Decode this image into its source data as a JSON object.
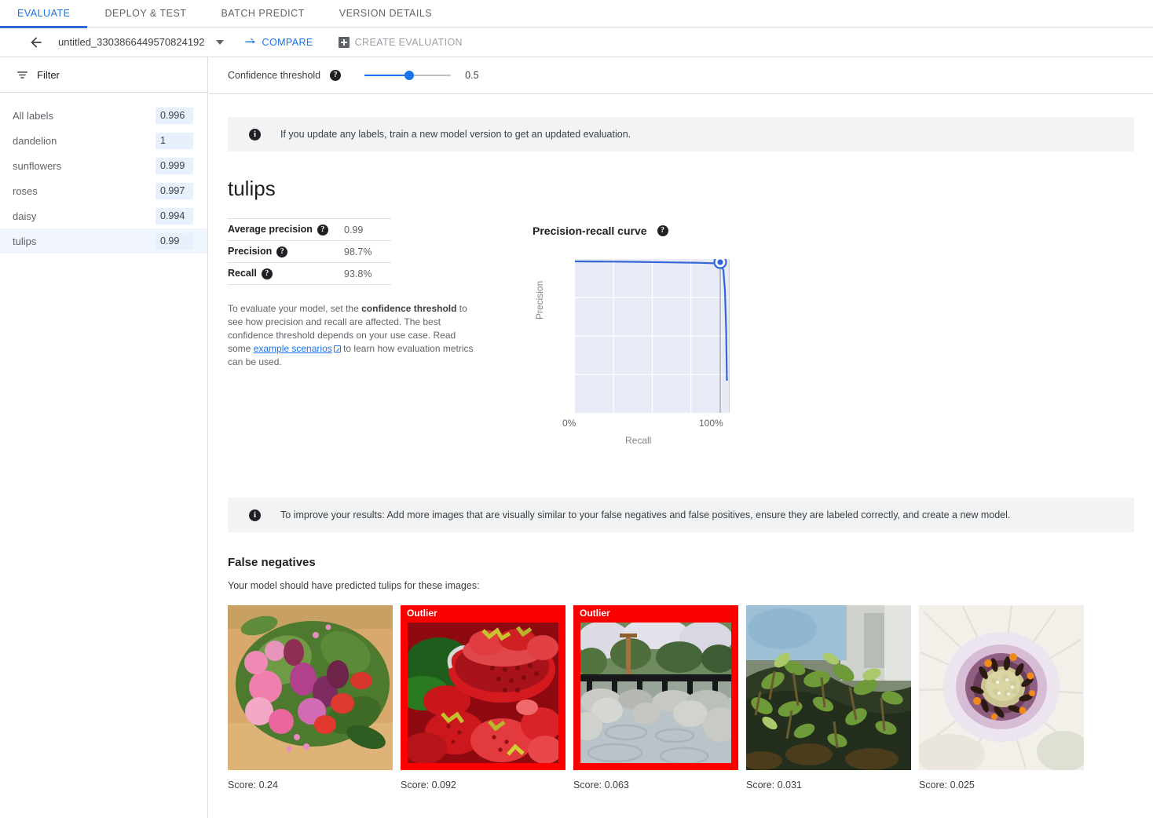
{
  "tabs": [
    {
      "label": "EVALUATE",
      "active": true
    },
    {
      "label": "DEPLOY & TEST",
      "active": false
    },
    {
      "label": "BATCH PREDICT",
      "active": false
    },
    {
      "label": "VERSION DETAILS",
      "active": false
    }
  ],
  "actionbar": {
    "back_icon": "arrow-back-icon",
    "model_name": "untitled_3303866449570824192",
    "dropdown_icon": "chevron-down-icon",
    "compare_label": "COMPARE",
    "compare_icon": "compare-arrow-icon",
    "create_evaluation_label": "CREATE EVALUATION",
    "create_evaluation_icon": "plus-square-icon"
  },
  "sidebar": {
    "filter_label": "Filter",
    "filter_icon": "filter-icon",
    "labels": [
      {
        "name": "All labels",
        "value": "0.996",
        "selected": false
      },
      {
        "name": "dandelion",
        "value": "1",
        "selected": false
      },
      {
        "name": "sunflowers",
        "value": "0.999",
        "selected": false
      },
      {
        "name": "roses",
        "value": "0.997",
        "selected": false
      },
      {
        "name": "daisy",
        "value": "0.994",
        "selected": false
      },
      {
        "name": "tulips",
        "value": "0.99",
        "selected": true
      }
    ]
  },
  "threshold": {
    "label": "Confidence threshold",
    "help_icon": "help-icon",
    "value": "0.5",
    "slider_percent": 52
  },
  "banners": {
    "top": {
      "icon": "info-icon",
      "text": "If you update any labels, train a new model version to get an updated evaluation."
    },
    "improve": {
      "icon": "info-icon",
      "text": "To improve your results: Add more images that are visually similar to your false negatives and false positives, ensure they are labeled correctly, and create a new model."
    }
  },
  "evaluation": {
    "title": "tulips",
    "metrics": [
      {
        "label": "Average precision",
        "value": "0.99",
        "help_icon": "help-icon"
      },
      {
        "label": "Precision",
        "value": "98.7%",
        "help_icon": "help-icon"
      },
      {
        "label": "Recall",
        "value": "93.8%",
        "help_icon": "help-icon"
      }
    ],
    "description_part1": "To evaluate your model, set the ",
    "description_bold": "confidence threshold",
    "description_part2": " to see how precision and recall are affected. The best confidence threshold depends on your use case. Read some ",
    "description_link": "example scenarios",
    "description_part3": " to learn how evaluation metrics can be used."
  },
  "chart_data": {
    "type": "line",
    "title": "Precision-recall curve",
    "help_icon": "help-icon",
    "xlabel": "Recall",
    "ylabel": "Precision",
    "xlim": [
      0,
      100
    ],
    "ylim": [
      0,
      100
    ],
    "x_tick_labels": [
      "0%",
      "100%"
    ],
    "grid": true,
    "grid_divisions": 4,
    "marker": {
      "x": 93.8,
      "y": 98.7,
      "label": "current threshold"
    },
    "series": [
      {
        "name": "tulips precision-recall",
        "x": [
          0,
          20,
          40,
          60,
          80,
          90,
          93.8,
          96,
          98,
          99,
          100,
          100
        ],
        "y": [
          99.5,
          99.4,
          99.3,
          99.2,
          99.0,
          98.9,
          98.7,
          96.0,
          92.0,
          80.0,
          55.0,
          22.0
        ]
      }
    ]
  },
  "false_negatives": {
    "title": "False negatives",
    "subtitle": "Your model should have predicted tulips for these images:",
    "items": [
      {
        "score_label": "Score: 0.24",
        "outlier": false,
        "outlier_label": "Outlier",
        "image": "bouquet-of-pink-tulips-and-roses"
      },
      {
        "score_label": "Score: 0.092",
        "outlier": true,
        "outlier_label": "Outlier",
        "image": "strawberries-in-red-colander"
      },
      {
        "score_label": "Score: 0.063",
        "outlier": true,
        "outlier_label": "Outlier",
        "image": "japanese-garden-stone-pond"
      },
      {
        "score_label": "Score: 0.031",
        "outlier": false,
        "outlier_label": "Outlier",
        "image": "green-sprouts-on-mossy-rock"
      },
      {
        "score_label": "Score: 0.025",
        "outlier": false,
        "outlier_label": "Outlier",
        "image": "white-daisy-flower-closeup"
      }
    ]
  },
  "colors": {
    "accent_blue": "#1a73e8",
    "tab_underline": "#3367d6",
    "chart_line": "#3367d6",
    "chart_fill": "#e8eaf6",
    "outlier_red": "#fc0000",
    "banner_bg": "#f1f3f4",
    "selected_row": "#f1f6fe",
    "value_chip": "#e8f0fe"
  }
}
